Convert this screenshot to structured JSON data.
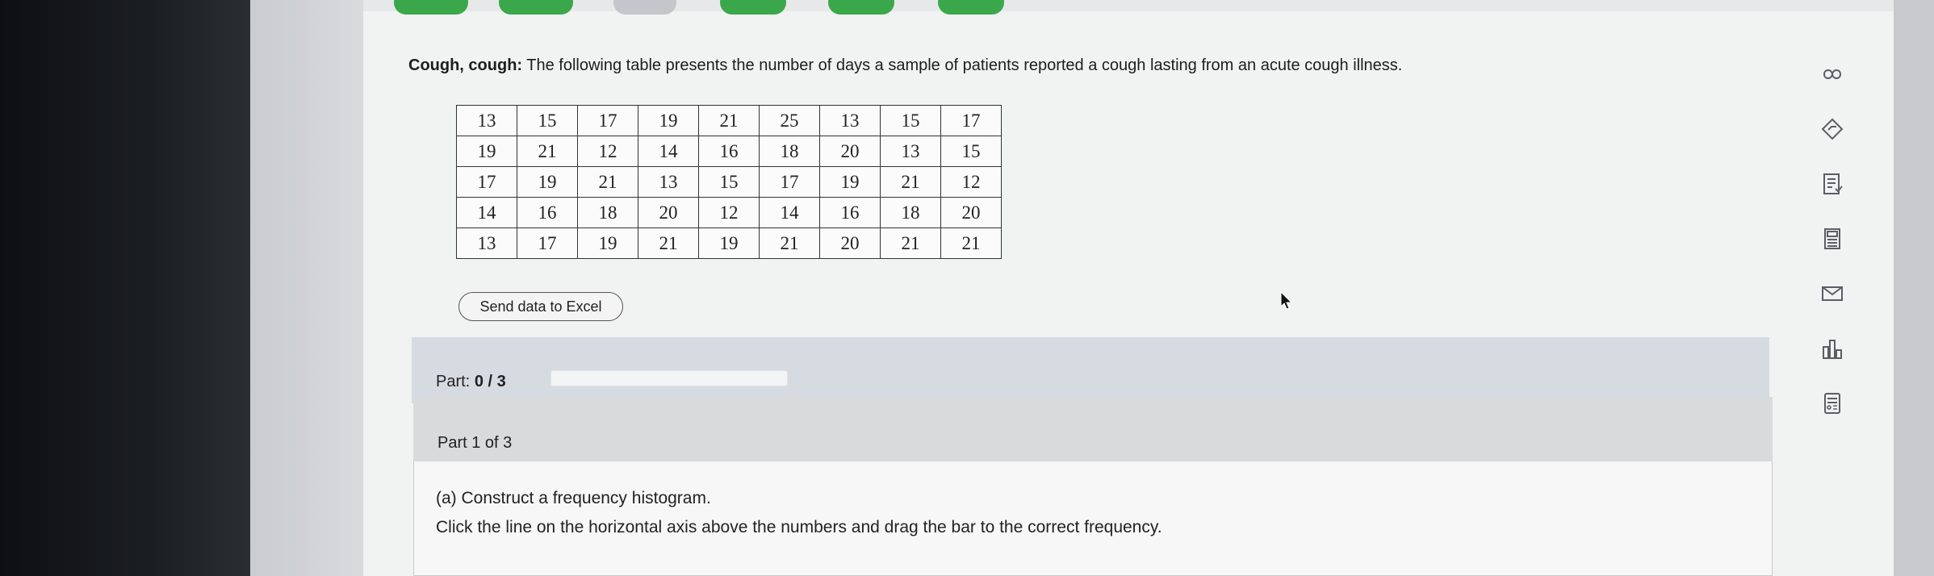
{
  "question": {
    "bold_lead": "Cough, cough:",
    "text": "The following table presents the number of days a sample of patients reported a cough lasting from an acute cough illness."
  },
  "table": {
    "rows": [
      [
        "13",
        "15",
        "17",
        "19",
        "21",
        "25",
        "13",
        "15",
        "17"
      ],
      [
        "19",
        "21",
        "12",
        "14",
        "16",
        "18",
        "20",
        "13",
        "15"
      ],
      [
        "17",
        "19",
        "21",
        "13",
        "15",
        "17",
        "19",
        "21",
        "12"
      ],
      [
        "14",
        "16",
        "18",
        "20",
        "12",
        "14",
        "16",
        "18",
        "20"
      ],
      [
        "13",
        "17",
        "19",
        "21",
        "19",
        "21",
        "20",
        "21",
        "21"
      ]
    ]
  },
  "excel_button": "Send data to Excel",
  "part_progress": {
    "label": "Part:",
    "value": "0 / 3",
    "fraction": 0
  },
  "part1": {
    "title": "Part 1 of 3",
    "instruction_a": "(a) Construct a frequency histogram.",
    "instruction_b": "Click the line on the horizontal axis above the numbers and drag the bar to the correct frequency."
  },
  "toolbar_icons": [
    "infinity-icon",
    "answer-tag-icon",
    "checklist-icon",
    "calculator-icon",
    "mail-icon",
    "bar-chart-icon",
    "formula-sheet-icon"
  ],
  "colors": {
    "accent_green": "#3aa84a",
    "part_bar": "#d6dbe1"
  }
}
